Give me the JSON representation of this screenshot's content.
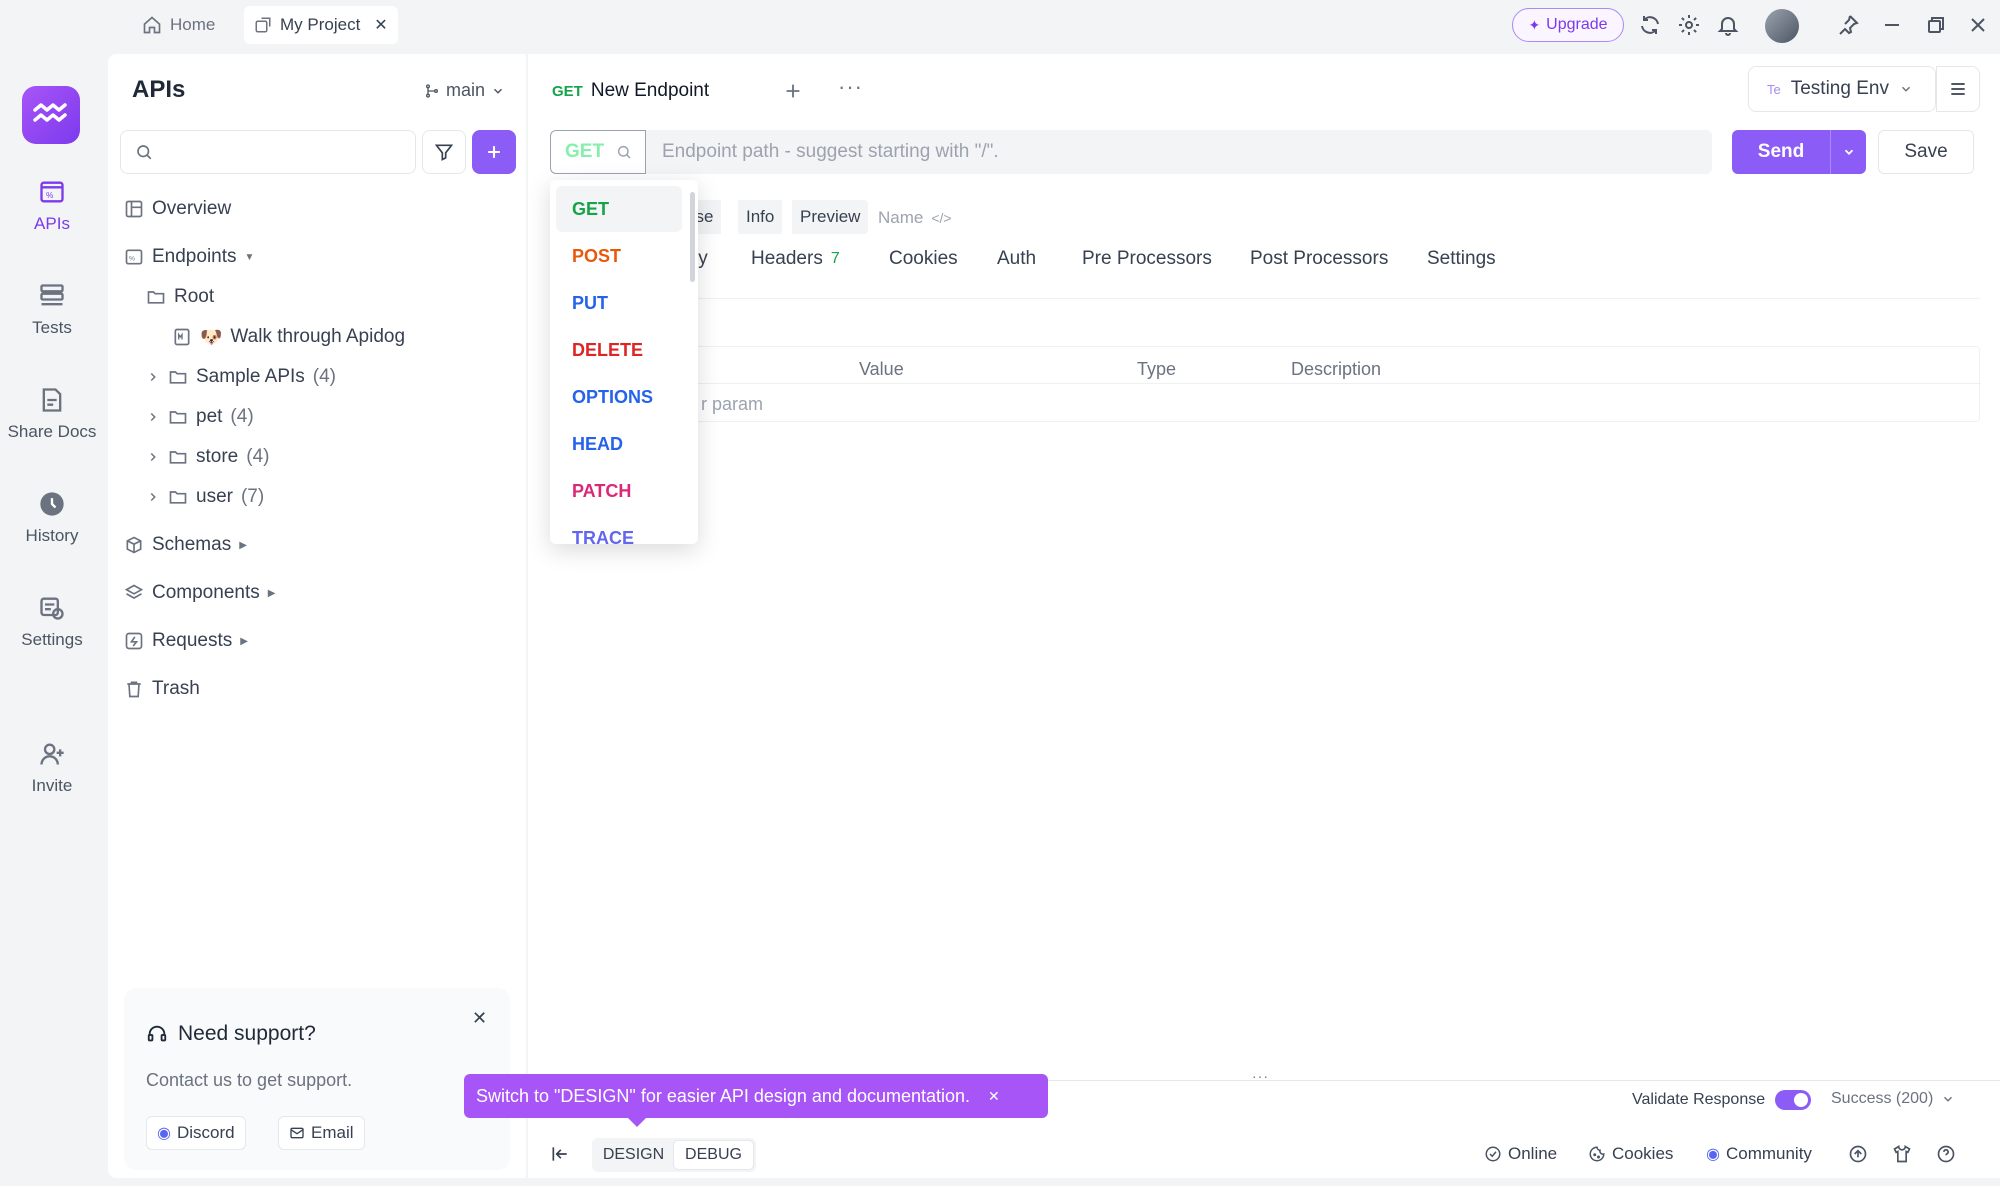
{
  "titlebar": {
    "tabs": [
      {
        "label": "Home",
        "icon": "home-icon"
      },
      {
        "label": "My Project",
        "icon": "external-link-icon"
      }
    ],
    "upgrade_label": "Upgrade"
  },
  "rail": {
    "items": [
      {
        "label": "APIs",
        "icon": "apis-icon",
        "active": true
      },
      {
        "label": "Tests",
        "icon": "tests-icon"
      },
      {
        "label": "Share Docs",
        "icon": "share-docs-icon"
      },
      {
        "label": "History",
        "icon": "history-icon"
      },
      {
        "label": "Settings",
        "icon": "settings-icon"
      },
      {
        "label": "Invite",
        "icon": "invite-icon"
      }
    ]
  },
  "sidebar": {
    "title": "APIs",
    "branch": "main",
    "search_placeholder": "",
    "tree": {
      "overview": "Overview",
      "endpoints": "Endpoints",
      "root": "Root",
      "walkthrough": "Walk through Apidog",
      "folders": [
        {
          "label": "Sample APIs",
          "count": "(4)"
        },
        {
          "label": "pet",
          "count": "(4)"
        },
        {
          "label": "store",
          "count": "(4)"
        },
        {
          "label": "user",
          "count": "(7)"
        }
      ],
      "schemas": "Schemas",
      "components": "Components",
      "requests": "Requests",
      "trash": "Trash"
    },
    "support": {
      "title": "Need support?",
      "subtitle": "Contact us to get support.",
      "discord": "Discord",
      "email": "Email"
    }
  },
  "main": {
    "tab": {
      "method": "GET",
      "title": "New Endpoint"
    },
    "env": {
      "badge": "Te",
      "label": "Testing Env"
    },
    "method": "GET",
    "url_placeholder": "Endpoint path - suggest starting with \"/\".",
    "send_label": "Send",
    "save_label": "Save",
    "subtabs": [
      "nse",
      "Info",
      "Preview"
    ],
    "name_placeholder": "Name",
    "request_tabs": [
      {
        "label": "ly"
      },
      {
        "label": "Headers",
        "count": "7"
      },
      {
        "label": "Cookies"
      },
      {
        "label": "Auth"
      },
      {
        "label": "Pre Processors"
      },
      {
        "label": "Post Processors"
      },
      {
        "label": "Settings"
      }
    ],
    "table": {
      "columns": [
        "Value",
        "Type",
        "Description"
      ],
      "add_param": "r param"
    },
    "validate_label": "Validate Response",
    "success_label": "Success (200)"
  },
  "dropdown": {
    "options": [
      {
        "label": "GET",
        "color": "#16a34a"
      },
      {
        "label": "POST",
        "color": "#ea580c"
      },
      {
        "label": "PUT",
        "color": "#2563eb"
      },
      {
        "label": "DELETE",
        "color": "#dc2626"
      },
      {
        "label": "OPTIONS",
        "color": "#2563eb"
      },
      {
        "label": "HEAD",
        "color": "#2563eb"
      },
      {
        "label": "PATCH",
        "color": "#db2777"
      },
      {
        "label": "TRACE",
        "color": "#6366f1"
      }
    ]
  },
  "tooltip": "Switch to \"DESIGN\" for easier API design and documentation.",
  "statusbar": {
    "design": "DESIGN",
    "debug": "DEBUG",
    "online": "Online",
    "cookies": "Cookies",
    "community": "Community"
  },
  "colors": {
    "accent": "#8b5cf6",
    "get": "#16a34a"
  }
}
